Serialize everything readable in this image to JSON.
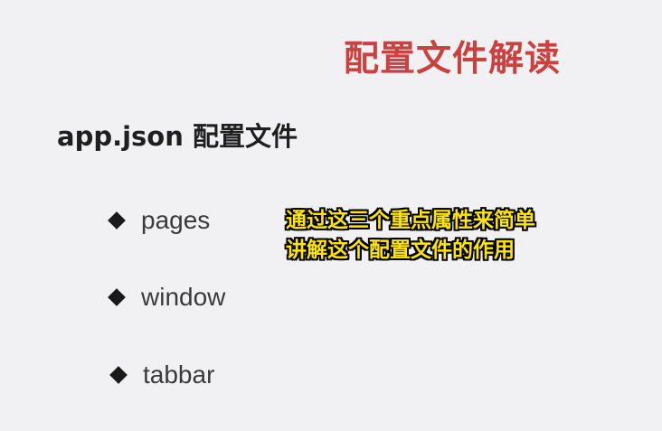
{
  "slide": {
    "title": "配置文件解读",
    "heading": "app.json 配置文件",
    "bullets": [
      {
        "label": "pages"
      },
      {
        "label": "window"
      },
      {
        "label": "tabbar"
      }
    ],
    "caption": {
      "lines": [
        "通过这三个重点属性来简单",
        "讲解这个配置文件的作用"
      ]
    },
    "colors": {
      "background": "#f1f0f3",
      "title": "#c9423f",
      "caption": "#ffe600"
    },
    "icons": {
      "bullet": "diamond-bullet-icon"
    }
  }
}
